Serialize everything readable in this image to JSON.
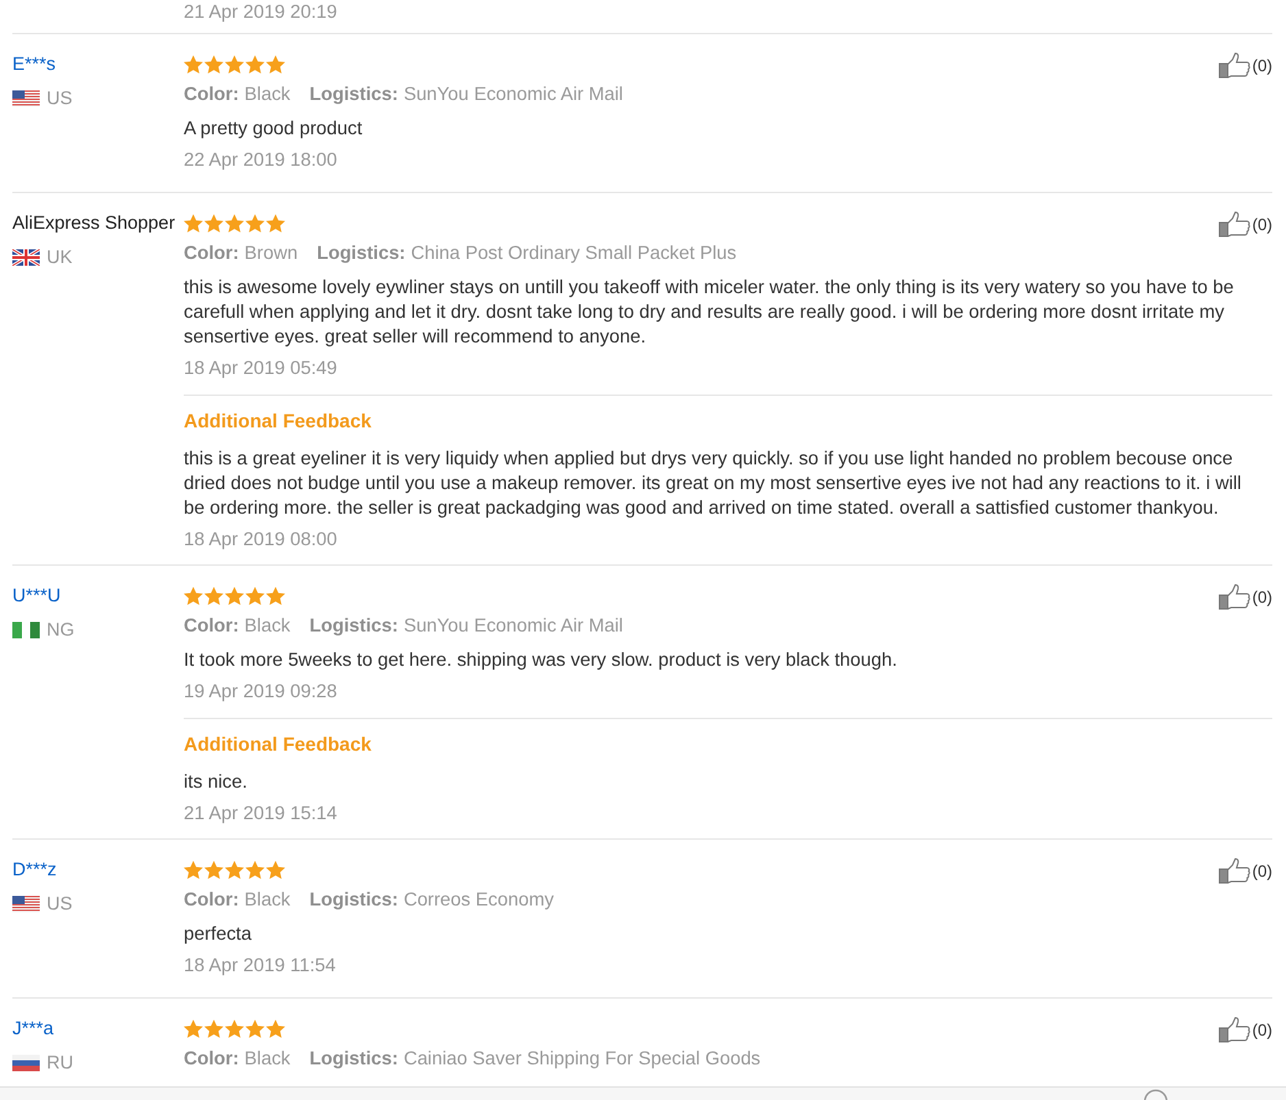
{
  "previous_review": {
    "date": "21 Apr 2019 20:19"
  },
  "reviews": [
    {
      "name": "E***s",
      "linked": true,
      "flag": {
        "kind": "us"
      },
      "country": "US",
      "stars": 5,
      "attributes": [
        {
          "label": "Color:",
          "value": "Black"
        },
        {
          "label": "Logistics:",
          "value": "SunYou Economic Air Mail"
        }
      ],
      "text": "A pretty good product",
      "date": "22 Apr 2019 18:00",
      "likes": "(0)"
    },
    {
      "name": "AliExpress Shopper",
      "linked": false,
      "flag": {
        "kind": "uk"
      },
      "country": "UK",
      "stars": 5,
      "attributes": [
        {
          "label": "Color:",
          "value": "Brown"
        },
        {
          "label": "Logistics:",
          "value": "China Post Ordinary Small Packet Plus"
        }
      ],
      "text": "this is awesome lovely eywliner stays on untill you takeoff with miceler water. the only thing is its very watery so you have to be carefull when applying and let it dry. dosnt take long to dry and results are really good. i will be ordering more dosnt irritate my sensertive eyes. great seller will recommend to anyone.",
      "date": "18 Apr 2019 05:49",
      "additional_feedback": {
        "heading": "Additional Feedback",
        "text": "this is a great eyeliner it is very liquidy when applied but drys very quickly. so if you use light handed no problem becouse once dried does not budge until you use a makeup remover. its great on my most sensertive eyes ive not had any reactions to it. i will be ordering more. the seller is great packadging was good and arrived on time stated. overall a sattisfied customer thankyou.",
        "date": "18 Apr 2019 08:00"
      },
      "likes": "(0)"
    },
    {
      "name": "U***U",
      "linked": true,
      "flag": {
        "kind": "ng"
      },
      "country": "NG",
      "stars": 5,
      "attributes": [
        {
          "label": "Color:",
          "value": "Black"
        },
        {
          "label": "Logistics:",
          "value": "SunYou Economic Air Mail"
        }
      ],
      "text": "It took more 5weeks to get here. shipping was very slow. product is very black though.",
      "date": "19 Apr 2019 09:28",
      "additional_feedback": {
        "heading": "Additional Feedback",
        "text": "its nice.",
        "date": "21 Apr 2019 15:14"
      },
      "likes": "(0)"
    },
    {
      "name": "D***z",
      "linked": true,
      "flag": {
        "kind": "us"
      },
      "country": "US",
      "stars": 5,
      "attributes": [
        {
          "label": "Color:",
          "value": "Black"
        },
        {
          "label": "Logistics:",
          "value": "Correos Economy"
        }
      ],
      "text": "perfecta",
      "date": "18 Apr 2019 11:54",
      "likes": "(0)"
    },
    {
      "name": "J***a",
      "linked": true,
      "flag": {
        "kind": "ru"
      },
      "country": "RU",
      "stars": 5,
      "attributes": [
        {
          "label": "Color:",
          "value": "Black"
        },
        {
          "label": "Logistics:",
          "value": "Cainiao Saver Shipping For Special Goods"
        }
      ],
      "likes": "(0)"
    }
  ]
}
